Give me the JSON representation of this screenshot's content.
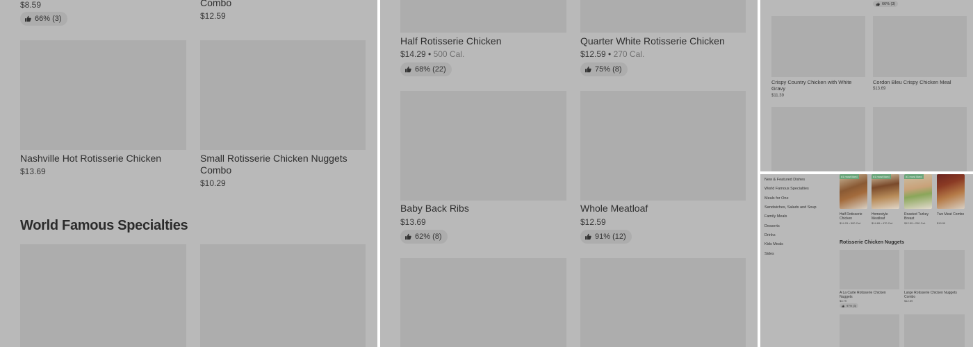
{
  "panel1": {
    "top_prices": [
      "$8.59",
      "$12.59"
    ],
    "top_combo_label": "Combo",
    "top_rating": "66% (3)",
    "items": [
      {
        "name": "Nashville Hot Rotisserie Chicken",
        "price": "$13.69"
      },
      {
        "name": "Small Rotisserie Chicken Nuggets Combo",
        "price": "$10.29"
      }
    ],
    "section_title": "World Famous Specialties"
  },
  "panel2": {
    "items": [
      {
        "name": "Half Rotisserie Chicken",
        "price": "$14.29",
        "cal": "500 Cal.",
        "rating": "68% (22)"
      },
      {
        "name": "Quarter White Rotisserie Chicken",
        "price": "$12.59",
        "cal": "270 Cal.",
        "rating": "75% (8)"
      },
      {
        "name": "Baby Back Ribs",
        "price": "$13.69",
        "rating": "62% (8)"
      },
      {
        "name": "Whole Meatloaf",
        "price": "$12.59",
        "rating": "91% (12)"
      }
    ]
  },
  "panel3": {
    "top_rating": "66% (3)",
    "items": [
      {
        "name": "Crispy Country Chicken with White Gravy",
        "price": "$11.39"
      },
      {
        "name": "Cordon Bleu Crispy Chicken Meal",
        "price": "$13.69"
      }
    ]
  },
  "panel4": {
    "nav": [
      "New & Featured Dishes",
      "World Famous Specialties",
      "Meals for One",
      "Sandwiches, Salads and Soup",
      "Family Meals",
      "Desserts",
      "Drinks",
      "Kids Meals",
      "Sides"
    ],
    "badge": "#1 most liked",
    "featured": [
      {
        "name": "Half Rotisserie Chicken",
        "price": "$14.29",
        "cal": "500 Cal."
      },
      {
        "name": "Homestyle Meatloaf",
        "price": "$14.89",
        "cal": "470 Cal."
      },
      {
        "name": "Roasted Turkey Breast",
        "price": "$12.59",
        "cal": "290 Cal."
      },
      {
        "name": "Two Meat Combo",
        "price": "$19.99"
      }
    ],
    "section_title": "Rotisserie Chicken Nuggets",
    "nuggets": [
      {
        "name": "A La Carte Rotisserie Chicken Nuggets",
        "price": "$3.79",
        "rating": "97% (3)"
      },
      {
        "name": "Large Rotisserie Chicken Nuggets Combo",
        "price": "$12.59"
      }
    ]
  },
  "colors": {
    "overlay": "#b9b9b9",
    "placeholder": "#adadad",
    "badge": "#6aa57a"
  }
}
